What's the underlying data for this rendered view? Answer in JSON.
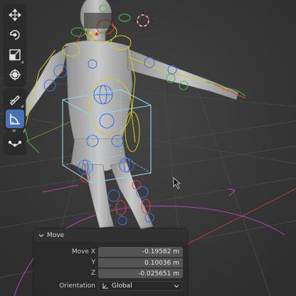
{
  "toolbar": {
    "tools": [
      {
        "name": "move-tool",
        "icon": "move-arrows-icon",
        "active": false
      },
      {
        "name": "rotate-tool",
        "icon": "rotate-icon",
        "active": false
      },
      {
        "name": "scale-tool",
        "icon": "scale-icon",
        "active": false
      },
      {
        "name": "transform-tool",
        "icon": "transform-icon",
        "active": false
      },
      {
        "name": "annotate-tool",
        "icon": "pencil-icon",
        "active": false
      },
      {
        "name": "measure-tool",
        "icon": "measure-icon",
        "active": true
      },
      {
        "name": "shear-tool",
        "icon": "curve-icon",
        "active": false
      }
    ]
  },
  "colors": {
    "accent": "#4772b3",
    "selection": "#8fd4e0",
    "bone_red": "#e83a3a",
    "bone_green": "#3fbf3f",
    "bone_blue": "#3a6fe8",
    "bone_yellow": "#d4c81e",
    "bone_magenta": "#c33fc3",
    "cursor_red": "#c83232"
  },
  "operator_panel": {
    "title": "Move",
    "fields": [
      {
        "label": "Move X",
        "value": "-0.19582 m"
      },
      {
        "label": "Y",
        "value": "0.10036 m"
      },
      {
        "label": "Z",
        "value": "-0.025651 m"
      }
    ],
    "orientation_label": "Orientation",
    "orientation_value": "Global"
  }
}
